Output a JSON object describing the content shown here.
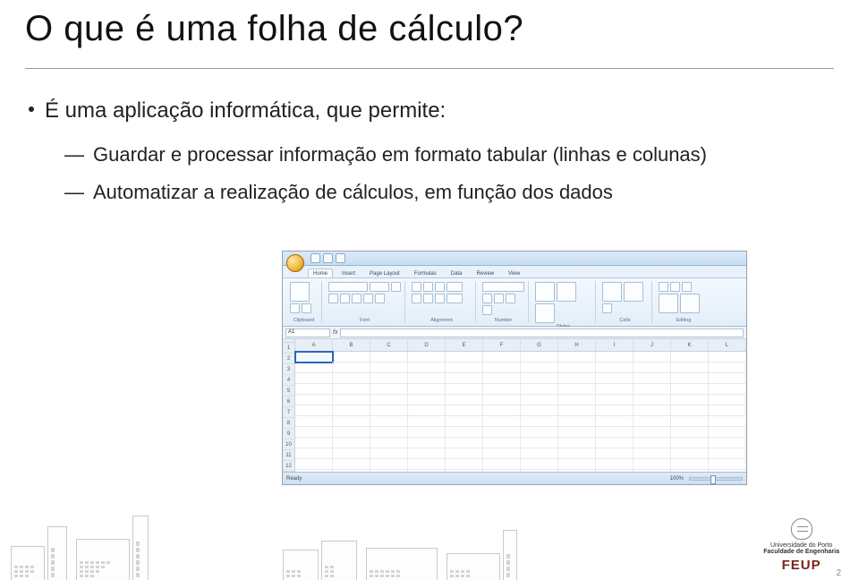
{
  "title": "O que é uma folha de cálculo?",
  "bullets": [
    {
      "text": "É uma aplicação informática, que permite:"
    }
  ],
  "subbullets": [
    {
      "text": "Guardar e processar informação em formato tabular (linhas e colunas)"
    },
    {
      "text": "Automatizar a realização de cálculos, em função dos dados"
    }
  ],
  "excel": {
    "tabs": [
      "Home",
      "Insert",
      "Page Layout",
      "Formulas",
      "Data",
      "Review",
      "View"
    ],
    "active_tab": 0,
    "groups": [
      "Clipboard",
      "Font",
      "Alignment",
      "Number",
      "Styles",
      "Cells",
      "Editing"
    ],
    "namebox": "A1",
    "columns": [
      "A",
      "B",
      "C",
      "D",
      "E",
      "F",
      "G",
      "H",
      "I",
      "J",
      "K",
      "L"
    ],
    "rows": [
      "1",
      "2",
      "3",
      "4",
      "5",
      "6",
      "7",
      "8",
      "9",
      "10",
      "11",
      "12"
    ],
    "status_left": "Ready",
    "zoom": "100%"
  },
  "footer": {
    "uni1": "Universidade do Porto",
    "uni2": "Faculdade de Engenharia",
    "feup": "FEUP",
    "page": "2"
  }
}
